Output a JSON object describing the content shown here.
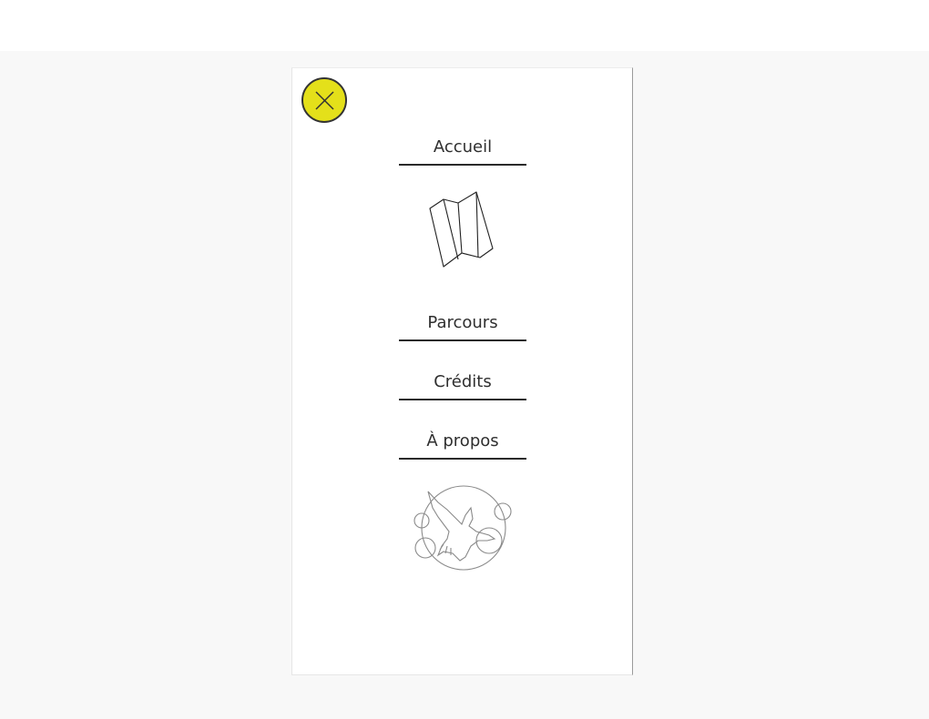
{
  "menu": {
    "items": [
      {
        "label": "Accueil"
      },
      {
        "label": "Parcours"
      },
      {
        "label": "Crédits"
      },
      {
        "label": "À propos"
      }
    ]
  },
  "icons": {
    "close": "close-icon",
    "map": "folded-map-icon",
    "logo": "bird-circle-logo"
  },
  "colors": {
    "accent": "#e4e01a",
    "text": "#2f2f2f",
    "underline": "#2a2a2a",
    "backdrop": "#f8f8f8"
  }
}
